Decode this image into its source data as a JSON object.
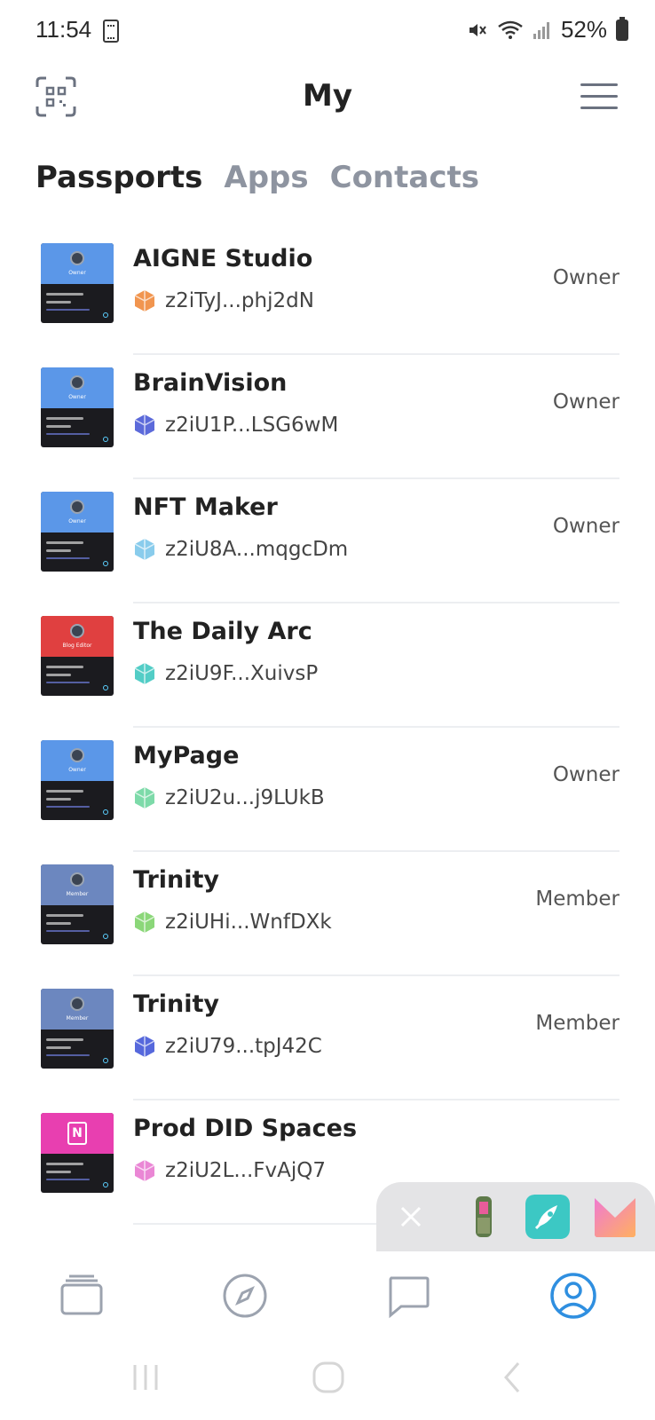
{
  "status_bar": {
    "time": "11:54",
    "battery": "52%"
  },
  "header": {
    "title": "My"
  },
  "tabs": [
    {
      "label": "Passports",
      "active": true
    },
    {
      "label": "Apps",
      "active": false
    },
    {
      "label": "Contacts",
      "active": false
    }
  ],
  "passports": [
    {
      "name": "AIGNE Studio",
      "did": "z2iTyJ...phj2dN",
      "role": "Owner",
      "card_color": "#5b97e8",
      "card_label": "Owner",
      "icon_color": "#f08a3c"
    },
    {
      "name": "BrainVision",
      "did": "z2iU1P...LSG6wM",
      "role": "Owner",
      "card_color": "#5b97e8",
      "card_label": "Owner",
      "icon_color": "#4a5ad6"
    },
    {
      "name": "NFT Maker",
      "did": "z2iU8A...mqgcDm",
      "role": "Owner",
      "card_color": "#5b97e8",
      "card_label": "Owner",
      "icon_color": "#7cc6ea"
    },
    {
      "name": "The Daily Arc",
      "did": "z2iU9F...XuivsP",
      "role": "",
      "card_color": "#e04040",
      "card_label": "Blog Editor",
      "icon_color": "#3fc8c0"
    },
    {
      "name": "MyPage",
      "did": "z2iU2u...j9LUkB",
      "role": "Owner",
      "card_color": "#5b97e8",
      "card_label": "Owner",
      "icon_color": "#6fd6a0"
    },
    {
      "name": "Trinity",
      "did": "z2iUHi...WnfDXk",
      "role": "Member",
      "card_color": "#6c87bf",
      "card_label": "Member",
      "icon_color": "#7ed36a"
    },
    {
      "name": "Trinity",
      "did": "z2iU79...tpJ42C",
      "role": "Member",
      "card_color": "#6c87bf",
      "card_label": "Member",
      "icon_color": "#4458d8"
    },
    {
      "name": "Prod DID Spaces",
      "did": "z2iU2L...FvAjQ7",
      "role": "",
      "card_color": "#e83fb0",
      "card_label": "",
      "icon_color": "#e87ad0"
    }
  ],
  "bottom_nav": [
    {
      "icon": "cards-icon",
      "active": false
    },
    {
      "icon": "compass-icon",
      "active": false
    },
    {
      "icon": "chat-icon",
      "active": false
    },
    {
      "icon": "profile-icon",
      "active": true
    }
  ],
  "colors": {
    "accent": "#2f8fe0",
    "muted": "#8e94a0"
  }
}
